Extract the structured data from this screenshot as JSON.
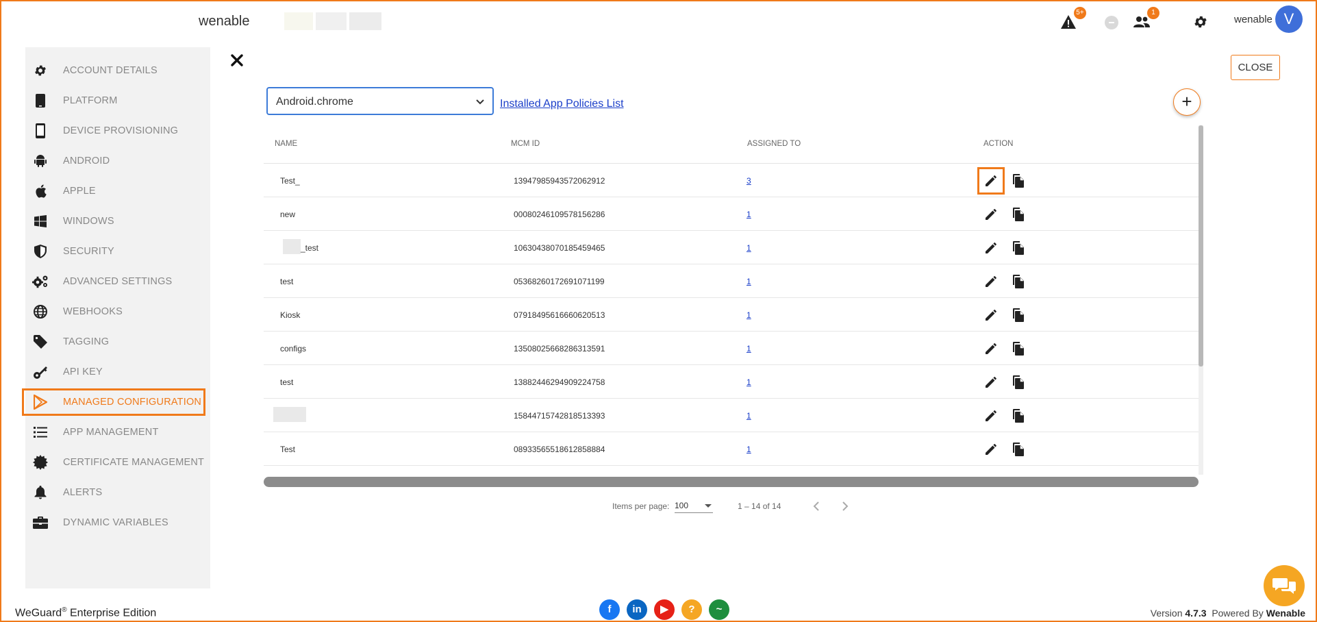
{
  "header": {
    "brand": "wenable",
    "alerts_badge": "5+",
    "users_badge": "1",
    "user_name": "wenable",
    "avatar_letter": "V"
  },
  "sidebar": {
    "items": [
      {
        "label": "ACCOUNT DETAILS",
        "icon": "gear-icon"
      },
      {
        "label": "PLATFORM",
        "icon": "tablet-icon"
      },
      {
        "label": "DEVICE PROVISIONING",
        "icon": "phone-icon"
      },
      {
        "label": "ANDROID",
        "icon": "android-icon"
      },
      {
        "label": "APPLE",
        "icon": "apple-icon"
      },
      {
        "label": "WINDOWS",
        "icon": "windows-icon"
      },
      {
        "label": "SECURITY",
        "icon": "shield-icon"
      },
      {
        "label": "ADVANCED SETTINGS",
        "icon": "gears-icon"
      },
      {
        "label": "WEBHOOKS",
        "icon": "globe-icon"
      },
      {
        "label": "TAGGING",
        "icon": "tag-icon"
      },
      {
        "label": "API KEY",
        "icon": "key-icon"
      },
      {
        "label": "MANAGED CONFIGURATION",
        "icon": "play-store-icon",
        "active": true
      },
      {
        "label": "APP MANAGEMENT",
        "icon": "list-icon"
      },
      {
        "label": "CERTIFICATE MANAGEMENT",
        "icon": "certificate-icon"
      },
      {
        "label": "ALERTS",
        "icon": "bell-icon"
      },
      {
        "label": "DYNAMIC VARIABLES",
        "icon": "briefcase-icon"
      }
    ]
  },
  "main": {
    "close_label": "CLOSE",
    "app_select_value": "Android.chrome",
    "policies_link": "Installed App Policies List",
    "add_label": "+"
  },
  "table": {
    "columns": [
      "NAME",
      "MCM ID",
      "ASSIGNED TO",
      "ACTION"
    ],
    "rows": [
      {
        "name": "Test_",
        "mcm_id": "13947985943572062912",
        "assigned": "3"
      },
      {
        "name": "new",
        "mcm_id": "00080246109578156286",
        "assigned": "1"
      },
      {
        "name": "_test",
        "mcm_id": "10630438070185459465",
        "assigned": "1",
        "masked": true
      },
      {
        "name": "test",
        "mcm_id": "05368260172691071199",
        "assigned": "1"
      },
      {
        "name": "Kiosk",
        "mcm_id": "07918495616660620513",
        "assigned": "1"
      },
      {
        "name": "configs",
        "mcm_id": "13508025668286313591",
        "assigned": "1"
      },
      {
        "name": "test",
        "mcm_id": "13882446294909224758",
        "assigned": "1"
      },
      {
        "name": "",
        "mcm_id": "15844715742818513393",
        "assigned": "1",
        "masked": true
      },
      {
        "name": "Test",
        "mcm_id": "08933565518612858884",
        "assigned": "1"
      }
    ]
  },
  "paginator": {
    "items_label": "Items per page:",
    "page_size": "100",
    "range": "1 – 14 of 14"
  },
  "footer": {
    "product": "WeGuard",
    "reg": "®",
    "edition": " Enterprise Edition",
    "version_prefix": "Version ",
    "version": "4.7.3",
    "powered_prefix": "Powered By ",
    "powered_by": "Wenable",
    "social": [
      {
        "name": "facebook",
        "glyph": "f",
        "color": "#1877f2"
      },
      {
        "name": "linkedin",
        "glyph": "in",
        "color": "#0a66c2"
      },
      {
        "name": "youtube",
        "glyph": "▶",
        "color": "#e62117"
      },
      {
        "name": "help",
        "glyph": "?",
        "color": "#f5a623"
      },
      {
        "name": "status",
        "glyph": "~",
        "color": "#1e8e3e"
      }
    ]
  },
  "colors": {
    "accent": "#f07a1a",
    "link": "#1a3ec9",
    "avatar": "#3f6fd9"
  }
}
